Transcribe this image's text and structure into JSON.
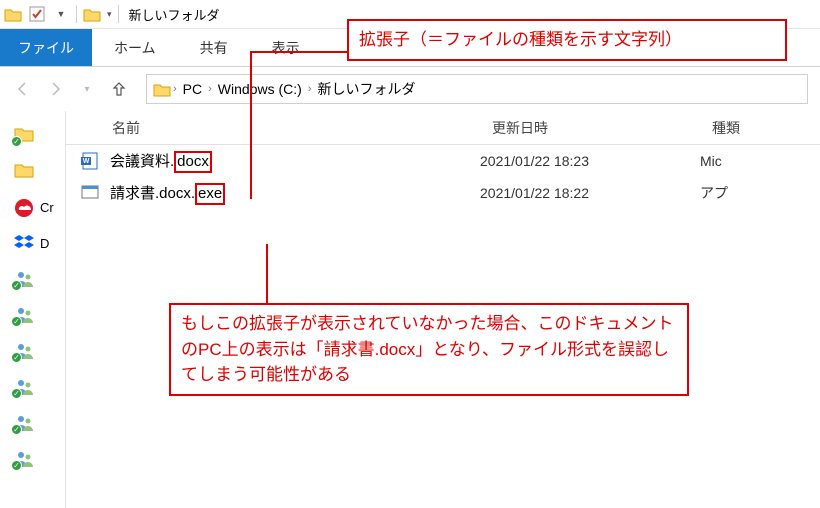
{
  "window": {
    "title": "新しいフォルダ"
  },
  "ribbon": {
    "file": "ファイル",
    "tabs": [
      "ホーム",
      "共有",
      "表示"
    ]
  },
  "breadcrumb": {
    "items": [
      "PC",
      "Windows (C:)",
      "新しいフォルダ"
    ]
  },
  "columns": {
    "name": "名前",
    "modified": "更新日時",
    "type": "種類"
  },
  "files": [
    {
      "name_base": "会議資料.",
      "name_hl": "docx",
      "name_tail": "",
      "date": "2021/01/22 18:23",
      "type": "Mic",
      "icon": "word"
    },
    {
      "name_base": "請求書.docx.",
      "name_hl": "exe",
      "name_tail": "",
      "date": "2021/01/22 18:22",
      "type": "アプ",
      "icon": "exe"
    }
  ],
  "sidebar": {
    "items": [
      {
        "label": "",
        "icon": "folder"
      },
      {
        "label": "",
        "icon": "folder"
      },
      {
        "label": "Cr",
        "icon": "cc"
      },
      {
        "label": "D",
        "icon": "dropbox"
      },
      {
        "label": "",
        "icon": "user"
      },
      {
        "label": "",
        "icon": "user"
      },
      {
        "label": "",
        "icon": "user"
      },
      {
        "label": "",
        "icon": "user"
      },
      {
        "label": "",
        "icon": "user"
      },
      {
        "label": "",
        "icon": "user"
      }
    ]
  },
  "annotations": {
    "top": "拡張子（＝ファイルの種類を示す文字列）",
    "bottom": "もしこの拡張子が表示されていなかった場合、このドキュメントのPC上の表示は「請求書.docx」となり、ファイル形式を誤認してしまう可能性がある"
  }
}
